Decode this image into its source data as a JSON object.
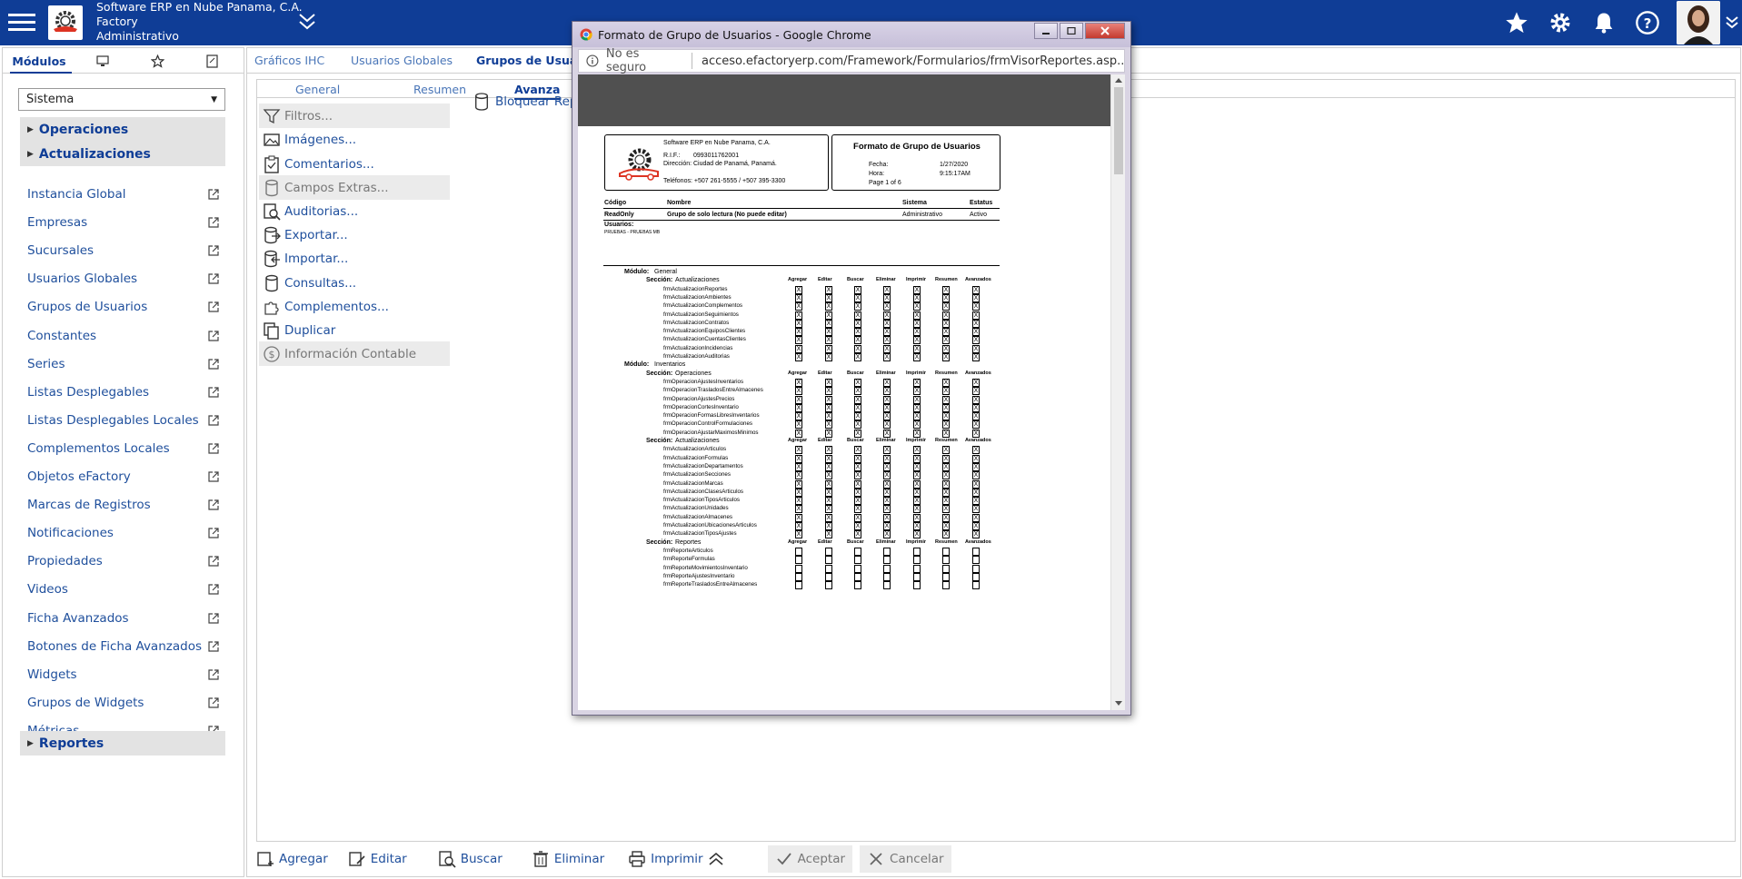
{
  "header": {
    "company": "Software ERP en Nube Panama, C.A.",
    "product": "Factory",
    "module": "Administrativo"
  },
  "left_tabs": {
    "modules_label": "Módulos"
  },
  "system_select": {
    "value": "Sistema"
  },
  "left_sections": {
    "operaciones": "Operaciones",
    "actualizaciones": "Actualizaciones",
    "reportes": "Reportes"
  },
  "left_items": [
    "Instancia Global",
    "Empresas",
    "Sucursales",
    "Usuarios Globales",
    "Grupos de Usuarios",
    "Constantes",
    "Series",
    "Listas Desplegables",
    "Listas Desplegables Locales",
    "Complementos Locales",
    "Objetos eFactory",
    "Marcas de Registros",
    "Notificaciones",
    "Propiedades",
    "Videos",
    "Ficha Avanzados",
    "Botones de Ficha Avanzados",
    "Widgets",
    "Grupos de Widgets",
    "Métricas"
  ],
  "main_tabs": [
    "Gráficos IHC",
    "Usuarios Globales",
    "Grupos de Usuari"
  ],
  "sub_tabs": [
    "General",
    "Resumen",
    "Avanza"
  ],
  "actions": [
    "Filtros...",
    "Imágenes...",
    "Comentarios...",
    "Campos Extras...",
    "Auditorias...",
    "Exportar...",
    "Importar...",
    "Consultas...",
    "Complementos...",
    "Duplicar",
    "Información Contable"
  ],
  "action2": "Bloquear Rep",
  "bottom_buttons": {
    "add": "Agregar",
    "edit": "Editar",
    "search": "Buscar",
    "delete": "Eliminar",
    "print": "Imprimir",
    "accept": "Aceptar",
    "cancel": "Cancelar"
  },
  "popup": {
    "title": "Formato de Grupo de Usuarios - Google Chrome",
    "not_secure": "No es seguro",
    "url": "acceso.efactoryerp.com/Framework/Formularios/frmVisorReportes.asp..."
  },
  "report": {
    "company": "Software ERP en Nube Panama, C.A.",
    "rif_label": "R.I.F.:",
    "rif": "0993011762001",
    "address_label": "Dirección:",
    "address": "Ciudad de Panamá, Panamá.",
    "phones": "Teléfonos: +507 261-5555 / +507 395-3300",
    "title": "Formato de Grupo de Usuarios",
    "date_label": "Fecha:",
    "date": "1/27/2020",
    "time_label": "Hora:",
    "time": "9:15:17AM",
    "page": "Page 1 of 6",
    "cols": {
      "code": "Código",
      "name": "Nombre",
      "system": "Sistema",
      "status": "Estatus"
    },
    "row": {
      "code": "ReadOnly",
      "name": "Grupo de solo lectura (No puede editar)",
      "system": "Administrativo",
      "status": "Activo"
    },
    "users_label": "Usuarios:",
    "users": "PRUEBAS - PRUEBAS MB",
    "module_label": "Módulo:",
    "section_label": "Sección:",
    "perm_cols": [
      "Agregar",
      "Editar",
      "Buscar",
      "Eliminar",
      "Imprimir",
      "Resumen",
      "Avanzados"
    ],
    "blocks": [
      {
        "module": "General",
        "section": "Actualizaciones",
        "checked": true,
        "items": [
          "frmActualizacionReportes",
          "frmActualizacionAmbientes",
          "frmActualizacionComplementos",
          "frmActualizacionSeguimientos",
          "frmActualizacionContratos",
          "frmActualizacionEquiposClientes",
          "frmActualizacionCuentasClientes",
          "frmActualizacionIncidencias",
          "frmActualizacionAuditorias"
        ]
      },
      {
        "module": "Inventarios",
        "section": "Operaciones",
        "checked": true,
        "items": [
          "frmOperacionAjustesInventarios",
          "frmOperacionTrasladosEntreAlmacenes",
          "frmOperacionAjustesPrecios",
          "frmOperacionCortesInventario",
          "frmOperacionFormasLibresInventarios",
          "frmOperacionControlFormulaciones",
          "frmOperacionAjustarMaximosMinimos"
        ]
      },
      {
        "module": "",
        "section": "Actualizaciones",
        "checked": true,
        "items": [
          "frmActualizacionArticulos",
          "frmActualizacionFormulas",
          "frmActualizacionDepartamentos",
          "frmActualizacionSecciones",
          "frmActualizacionMarcas",
          "frmActualizacionClasesArticulos",
          "frmActualizacionTiposArticulos",
          "frmActualizacionUnidades",
          "frmActualizacionAlmacenes",
          "frmActualizacionUbicacionesArticulos",
          "frmActualizacionTiposAjustes"
        ]
      },
      {
        "module": "",
        "section": "Reportes",
        "checked": false,
        "items": [
          "frmReporteArticulos",
          "frmReporteFormulas",
          "frmReporteMovimientosInventario",
          "frmReporteAjustesInventario",
          "frmReporteTrasladosEntreAlmacenes"
        ]
      }
    ]
  }
}
